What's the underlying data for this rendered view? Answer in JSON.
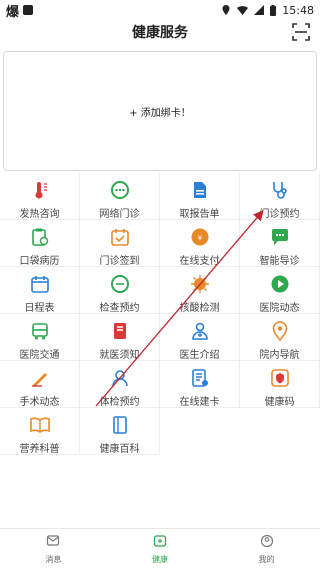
{
  "status_bar": {
    "left_glyph": "爆",
    "time": "15:48"
  },
  "header": {
    "title": "健康服务",
    "scan_icon": "scan-icon"
  },
  "bind_card": {
    "label": "+  添加绑卡！"
  },
  "colors": {
    "accent": "#2fa84f",
    "blue": "#2b7fd8",
    "orange": "#e88a2a",
    "red": "#d93a3a",
    "arrow": "#c0262b"
  },
  "services": [
    {
      "label": "发热咨询",
      "icon": "thermometer-icon"
    },
    {
      "label": "网络门诊",
      "icon": "chat-icon"
    },
    {
      "label": "取报告单",
      "icon": "report-icon"
    },
    {
      "label": "门诊预约",
      "icon": "stethoscope-icon"
    },
    {
      "label": "口袋病历",
      "icon": "clipboard-icon"
    },
    {
      "label": "门诊签到",
      "icon": "calendar-check-icon"
    },
    {
      "label": "在线支付",
      "icon": "payment-icon"
    },
    {
      "label": "智能导诊",
      "icon": "smart-chat-icon"
    },
    {
      "label": "日程表",
      "icon": "schedule-icon"
    },
    {
      "label": "检查预约",
      "icon": "exam-chat-icon"
    },
    {
      "label": "核酸检测",
      "icon": "virus-icon"
    },
    {
      "label": "医院动态",
      "icon": "play-icon"
    },
    {
      "label": "医院交通",
      "icon": "bus-icon"
    },
    {
      "label": "就医须知",
      "icon": "book-icon"
    },
    {
      "label": "医生介绍",
      "icon": "doctor-icon"
    },
    {
      "label": "院内导航",
      "icon": "location-icon"
    },
    {
      "label": "手术动态",
      "icon": "scalpel-icon"
    },
    {
      "label": "体检预约",
      "icon": "checkup-icon"
    },
    {
      "label": "在线建卡",
      "icon": "card-icon"
    },
    {
      "label": "健康码",
      "icon": "shield-code-icon"
    },
    {
      "label": "营养科普",
      "icon": "open-book-icon"
    },
    {
      "label": "健康百科",
      "icon": "encyclopedia-icon"
    }
  ],
  "tabbar": [
    {
      "label": "消息",
      "icon": "message-icon",
      "active": false
    },
    {
      "label": "健康",
      "icon": "health-icon",
      "active": true
    },
    {
      "label": "我的",
      "icon": "profile-icon",
      "active": false
    }
  ]
}
